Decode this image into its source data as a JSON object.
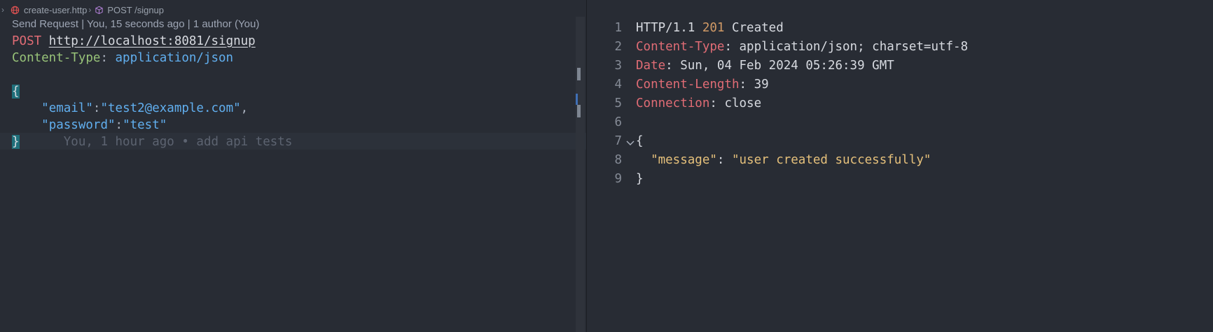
{
  "breadcrumb": {
    "file": "create-user.http",
    "request": "POST /signup"
  },
  "left": {
    "codelens": "Send Request | You, 15 seconds ago | 1 author (You)",
    "method": "POST",
    "url": "http://localhost:8081/signup",
    "header_name": "Content-Type",
    "header_sep": ": ",
    "header_value": "application/json",
    "open_brace": "{",
    "close_brace": "}",
    "email_key": "\"email\"",
    "email_value": "\"test2@example.com\"",
    "password_key": "\"password\"",
    "password_value": "\"test\"",
    "blame": "You, 1 hour ago • add api tests"
  },
  "right": {
    "line_numbers": [
      "1",
      "2",
      "3",
      "4",
      "5",
      "6",
      "7",
      "8",
      "9"
    ],
    "status_proto": "HTTP/1.1 ",
    "status_code": "201",
    "status_text": " Created",
    "headers": [
      {
        "name": "Content-Type",
        "value": "application/json; charset=utf-8"
      },
      {
        "name": "Date",
        "value": "Sun, 04 Feb 2024 05:26:39 GMT"
      },
      {
        "name": "Content-Length",
        "value": "39"
      },
      {
        "name": "Connection",
        "value": "close"
      }
    ],
    "body_open": "{",
    "body_key": "\"message\"",
    "body_value": "\"user created successfully\"",
    "body_close": "}"
  },
  "colors": {
    "background": "#282c34",
    "method": "#e06c75",
    "header_name_request": "#98c379",
    "json_string": "#61afef",
    "response_header_name": "#e06c75",
    "status_code": "#d19a66",
    "response_json": "#e5c07b"
  },
  "icons": {
    "file": "globe-icon",
    "request": "cube-icon",
    "fold": "chevron-down-icon",
    "breadcrumb_separator": "chevron-right-icon"
  }
}
